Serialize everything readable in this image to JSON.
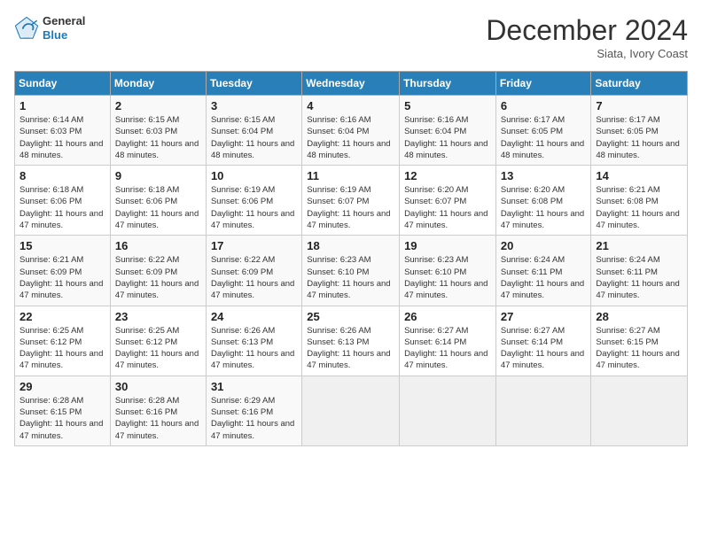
{
  "header": {
    "logo_general": "General",
    "logo_blue": "Blue",
    "month_title": "December 2024",
    "subtitle": "Siata, Ivory Coast"
  },
  "weekdays": [
    "Sunday",
    "Monday",
    "Tuesday",
    "Wednesday",
    "Thursday",
    "Friday",
    "Saturday"
  ],
  "weeks": [
    [
      {
        "day": "1",
        "info": "Sunrise: 6:14 AM\nSunset: 6:03 PM\nDaylight: 11 hours and 48 minutes."
      },
      {
        "day": "2",
        "info": "Sunrise: 6:15 AM\nSunset: 6:03 PM\nDaylight: 11 hours and 48 minutes."
      },
      {
        "day": "3",
        "info": "Sunrise: 6:15 AM\nSunset: 6:04 PM\nDaylight: 11 hours and 48 minutes."
      },
      {
        "day": "4",
        "info": "Sunrise: 6:16 AM\nSunset: 6:04 PM\nDaylight: 11 hours and 48 minutes."
      },
      {
        "day": "5",
        "info": "Sunrise: 6:16 AM\nSunset: 6:04 PM\nDaylight: 11 hours and 48 minutes."
      },
      {
        "day": "6",
        "info": "Sunrise: 6:17 AM\nSunset: 6:05 PM\nDaylight: 11 hours and 48 minutes."
      },
      {
        "day": "7",
        "info": "Sunrise: 6:17 AM\nSunset: 6:05 PM\nDaylight: 11 hours and 48 minutes."
      }
    ],
    [
      {
        "day": "8",
        "info": "Sunrise: 6:18 AM\nSunset: 6:06 PM\nDaylight: 11 hours and 47 minutes."
      },
      {
        "day": "9",
        "info": "Sunrise: 6:18 AM\nSunset: 6:06 PM\nDaylight: 11 hours and 47 minutes."
      },
      {
        "day": "10",
        "info": "Sunrise: 6:19 AM\nSunset: 6:06 PM\nDaylight: 11 hours and 47 minutes."
      },
      {
        "day": "11",
        "info": "Sunrise: 6:19 AM\nSunset: 6:07 PM\nDaylight: 11 hours and 47 minutes."
      },
      {
        "day": "12",
        "info": "Sunrise: 6:20 AM\nSunset: 6:07 PM\nDaylight: 11 hours and 47 minutes."
      },
      {
        "day": "13",
        "info": "Sunrise: 6:20 AM\nSunset: 6:08 PM\nDaylight: 11 hours and 47 minutes."
      },
      {
        "day": "14",
        "info": "Sunrise: 6:21 AM\nSunset: 6:08 PM\nDaylight: 11 hours and 47 minutes."
      }
    ],
    [
      {
        "day": "15",
        "info": "Sunrise: 6:21 AM\nSunset: 6:09 PM\nDaylight: 11 hours and 47 minutes."
      },
      {
        "day": "16",
        "info": "Sunrise: 6:22 AM\nSunset: 6:09 PM\nDaylight: 11 hours and 47 minutes."
      },
      {
        "day": "17",
        "info": "Sunrise: 6:22 AM\nSunset: 6:09 PM\nDaylight: 11 hours and 47 minutes."
      },
      {
        "day": "18",
        "info": "Sunrise: 6:23 AM\nSunset: 6:10 PM\nDaylight: 11 hours and 47 minutes."
      },
      {
        "day": "19",
        "info": "Sunrise: 6:23 AM\nSunset: 6:10 PM\nDaylight: 11 hours and 47 minutes."
      },
      {
        "day": "20",
        "info": "Sunrise: 6:24 AM\nSunset: 6:11 PM\nDaylight: 11 hours and 47 minutes."
      },
      {
        "day": "21",
        "info": "Sunrise: 6:24 AM\nSunset: 6:11 PM\nDaylight: 11 hours and 47 minutes."
      }
    ],
    [
      {
        "day": "22",
        "info": "Sunrise: 6:25 AM\nSunset: 6:12 PM\nDaylight: 11 hours and 47 minutes."
      },
      {
        "day": "23",
        "info": "Sunrise: 6:25 AM\nSunset: 6:12 PM\nDaylight: 11 hours and 47 minutes."
      },
      {
        "day": "24",
        "info": "Sunrise: 6:26 AM\nSunset: 6:13 PM\nDaylight: 11 hours and 47 minutes."
      },
      {
        "day": "25",
        "info": "Sunrise: 6:26 AM\nSunset: 6:13 PM\nDaylight: 11 hours and 47 minutes."
      },
      {
        "day": "26",
        "info": "Sunrise: 6:27 AM\nSunset: 6:14 PM\nDaylight: 11 hours and 47 minutes."
      },
      {
        "day": "27",
        "info": "Sunrise: 6:27 AM\nSunset: 6:14 PM\nDaylight: 11 hours and 47 minutes."
      },
      {
        "day": "28",
        "info": "Sunrise: 6:27 AM\nSunset: 6:15 PM\nDaylight: 11 hours and 47 minutes."
      }
    ],
    [
      {
        "day": "29",
        "info": "Sunrise: 6:28 AM\nSunset: 6:15 PM\nDaylight: 11 hours and 47 minutes."
      },
      {
        "day": "30",
        "info": "Sunrise: 6:28 AM\nSunset: 6:16 PM\nDaylight: 11 hours and 47 minutes."
      },
      {
        "day": "31",
        "info": "Sunrise: 6:29 AM\nSunset: 6:16 PM\nDaylight: 11 hours and 47 minutes."
      },
      null,
      null,
      null,
      null
    ]
  ]
}
